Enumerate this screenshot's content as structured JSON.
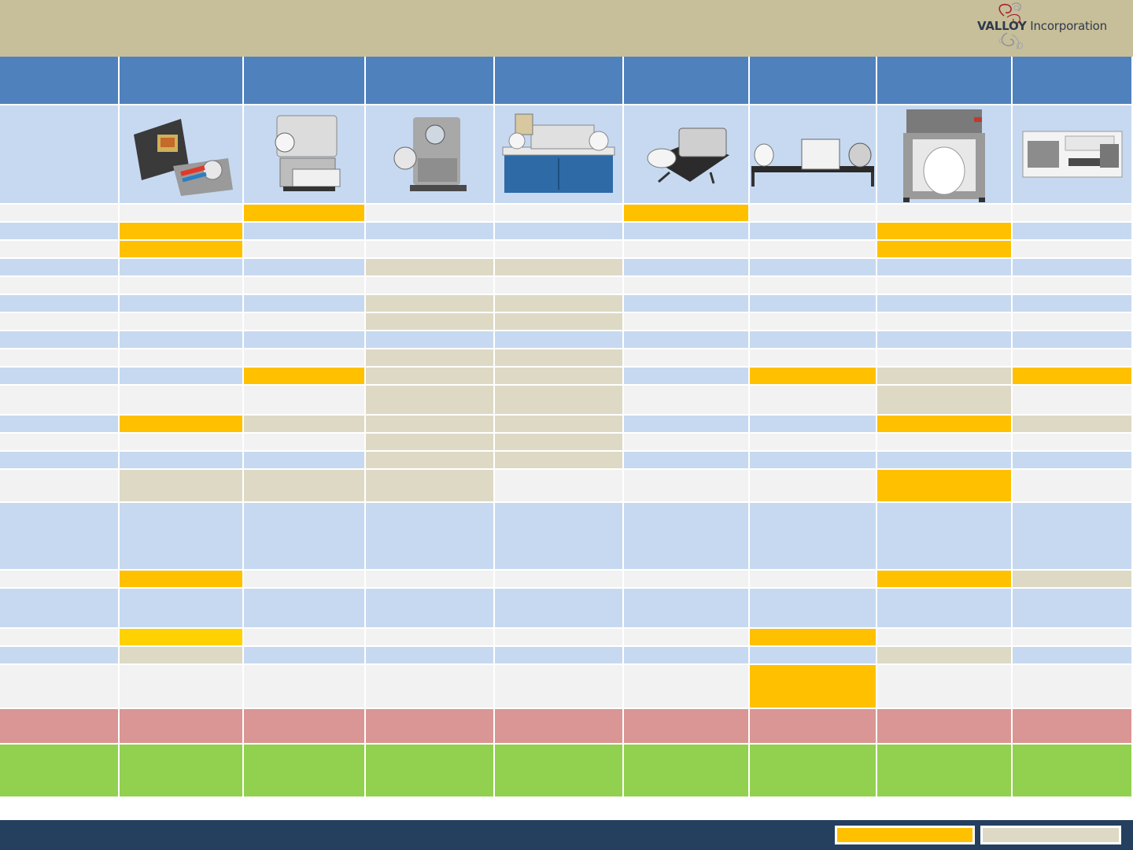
{
  "header": {
    "logo": {
      "brand": "VALLOY",
      "suffix": " Incorporation"
    }
  },
  "colors": {
    "header_bg": "#c7be9a",
    "column_header": "#4f81bd",
    "row_blue": "#c6d9f0",
    "row_white": "#f2f2f2",
    "highlight_gold": "#ffc000",
    "highlight_tan": "#ddd9c4",
    "price_row": "#d99694",
    "summary_row": "#92d050",
    "footer_bg": "#253f5f"
  },
  "printers": [
    {
      "icon": "desktop-label-printer-with-unwinder-icon"
    },
    {
      "icon": "compact-laser-label-printer-icon"
    },
    {
      "icon": "roll-fed-inkjet-label-printer-icon"
    },
    {
      "icon": "cabinet-label-press-with-rolls-icon"
    },
    {
      "icon": "tabletop-label-printer-icon"
    },
    {
      "icon": "wide-format-roll-to-roll-printer-icon"
    },
    {
      "icon": "tall-floor-standing-label-printer-icon"
    },
    {
      "icon": "axxis-hs-label-printer-icon"
    }
  ],
  "cell_map": [
    "WGWWGWWW",
    "GBBBBBGB",
    "GWWWWWGW",
    "BBTTBBBB",
    "WWWWWWWW",
    "BBTTBBBB",
    "WWTTWWWW",
    "BBBBBBBB",
    "WWTTWWWW",
    "BGTTBGTG",
    "WWTTWWTW",
    "GTTTBBGT",
    "WWTTWWWW",
    "BBTTBBBB",
    "TTTWWWGW",
    "BBBBBBBB",
    "GWWWWWGT",
    "BBBBBBBB",
    "YWWWWGWW",
    "TBBBBBTB",
    "WWWWWGWW",
    "PPPPPPPP",
    "SSSSSSSS"
  ],
  "legend": [
    {
      "color": "#ffc000"
    },
    {
      "color": "#ddd9c4"
    }
  ]
}
